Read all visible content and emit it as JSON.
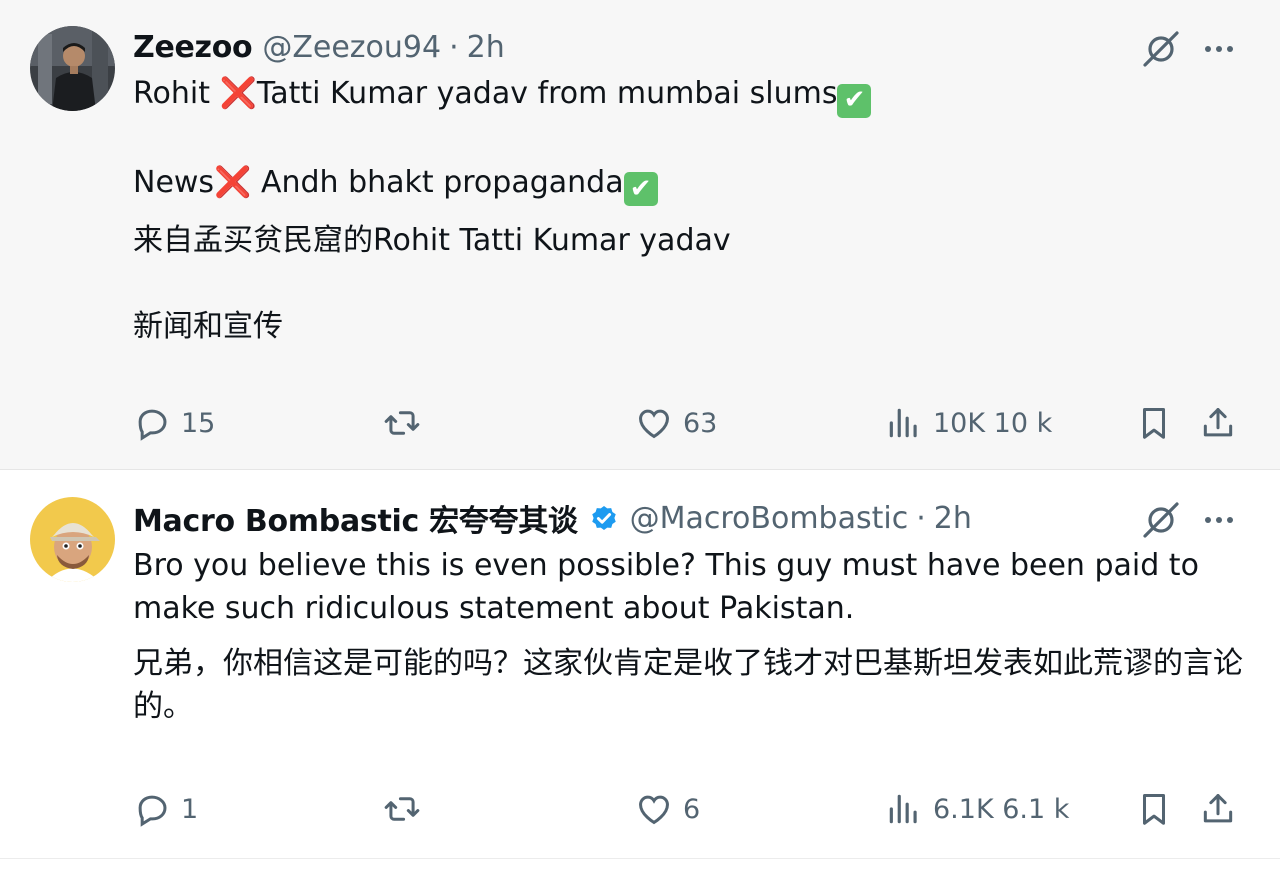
{
  "tweets": [
    {
      "display_name": "Zeezoo",
      "handle": "@Zeezou94",
      "separator": "·",
      "time": "2h",
      "verified": false,
      "body": {
        "line1_a": "Rohit ",
        "line1_x": "❌",
        "line1_b": "Tatti Kumar yadav from mumbai slums",
        "line1_check": "✔",
        "line2_a": "News",
        "line2_x": "❌",
        "line2_b": " Andh bhakt propaganda",
        "line2_check": "✔",
        "line3": "来自孟买贫民窟的Rohit Tatti Kumar yadav",
        "line4": "新闻和宣传"
      },
      "actions": {
        "replies": "15",
        "reposts": "",
        "likes": "63",
        "views": "10K 10 k"
      }
    },
    {
      "display_name": "Macro Bombastic 宏夸夸其谈",
      "handle": "@MacroBombastic",
      "separator": "·",
      "time": "2h",
      "verified": true,
      "body": {
        "line1": "Bro you believe this is even possible? This guy must have been paid to make such ridiculous statement about Pakistan.",
        "line2": "兄弟，你相信这是可能的吗？这家伙肯定是收了钱才对巴基斯坦发表如此荒谬的言论的。"
      },
      "actions": {
        "replies": "1",
        "reposts": "",
        "likes": "6",
        "views": "6.1K 6.1 k"
      }
    }
  ],
  "icons": [
    "grok-icon",
    "more-icon",
    "reply-icon",
    "repost-icon",
    "like-icon",
    "views-icon",
    "bookmark-icon",
    "share-icon",
    "verified-badge-icon"
  ],
  "colors": {
    "text": "#0f1419",
    "secondary": "#536471",
    "verified": "#1d9bf0",
    "check_green": "#5ec16a",
    "cross_red": "#e0245e"
  }
}
